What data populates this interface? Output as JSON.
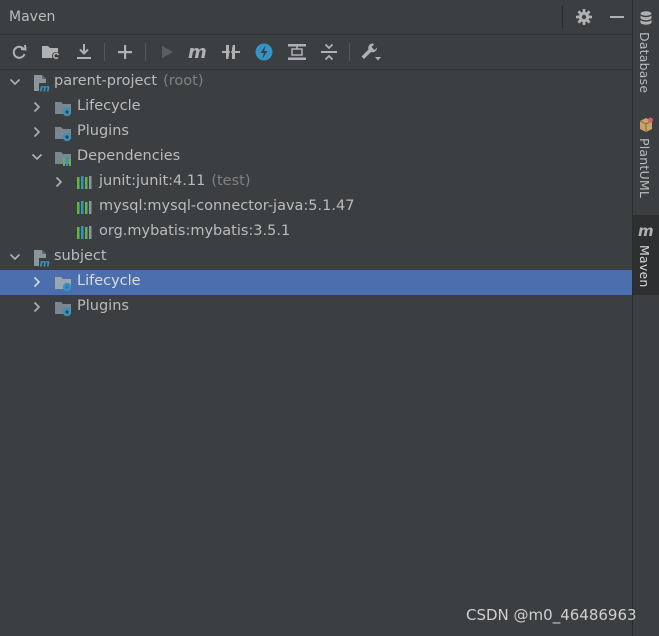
{
  "window": {
    "title": "Maven"
  },
  "header": {
    "settings_icon": "gear-icon",
    "minimize_icon": "minimize-icon"
  },
  "toolbar": {
    "buttons": [
      {
        "name": "reload-all-button",
        "icon": "reload-icon"
      },
      {
        "name": "generate-sources-button",
        "icon": "folder-refresh-icon"
      },
      {
        "name": "download-sources-button",
        "icon": "download-icon"
      },
      {
        "name": "add-maven-project-button",
        "icon": "plus-icon"
      },
      {
        "name": "run-maven-build-button",
        "icon": "play-icon"
      },
      {
        "name": "execute-maven-goal-button",
        "icon": "maven-m-icon"
      },
      {
        "name": "toggle-offline-mode-button",
        "icon": "offline-icon"
      },
      {
        "name": "skip-tests-button",
        "icon": "lightning-icon"
      },
      {
        "name": "show-dependencies-button",
        "icon": "diagram-icon"
      },
      {
        "name": "collapse-all-button",
        "icon": "collapse-all-icon"
      },
      {
        "name": "maven-settings-button",
        "icon": "wrench-icon"
      }
    ]
  },
  "tree": {
    "project1": {
      "label": "parent-project",
      "suffix": "(root)"
    },
    "p1_lifecycle": "Lifecycle",
    "p1_plugins": "Plugins",
    "p1_dependencies": "Dependencies",
    "dep1": {
      "label": "junit:junit:4.11",
      "suffix": "(test)"
    },
    "dep2": {
      "label": "mysql:mysql-connector-java:5.1.47"
    },
    "dep3": {
      "label": "org.mybatis:mybatis:3.5.1"
    },
    "project2": {
      "label": "subject"
    },
    "p2_lifecycle": "Lifecycle",
    "p2_plugins": "Plugins"
  },
  "sidebar": {
    "tabs": [
      {
        "label": "Database",
        "icon": "database-icon"
      },
      {
        "label": "PlantUML",
        "icon": "plantuml-icon"
      },
      {
        "label": "Maven",
        "icon": "maven-m-icon",
        "active": true
      }
    ]
  },
  "watermark": "CSDN @m0_46486963",
  "colors": {
    "background": "#3c3f41",
    "selection": "#4b6eaf",
    "folder": "#7a8791",
    "accent_blue": "#3592c4",
    "dep_green": "#62b543"
  }
}
